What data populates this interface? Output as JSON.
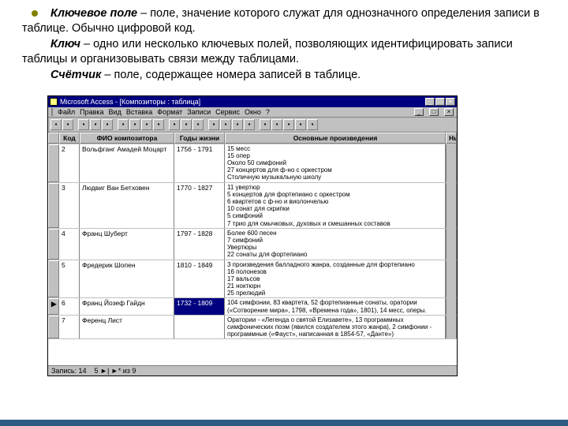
{
  "paragraphs": {
    "p1_term": "Ключевое поле",
    "p1_rest": " – поле, значение которого служат для однозначного определения записи в таблице. Обычно цифровой код.",
    "p2_term": "Ключ",
    "p2_rest": " – одно или несколько ключевых полей, позволяющих идентифицировать записи таблицы и организовывать связи между таблицами.",
    "p3_term": "Счётчик",
    "p3_rest": "  –  поле, содержащее номера записей в таблице."
  },
  "app": {
    "title": "Microsoft Access - [Композиторы : таблица]",
    "menu": [
      "Файл",
      "Правка",
      "Вид",
      "Вставка",
      "Формат",
      "Записи",
      "Сервис",
      "Окно",
      "?"
    ],
    "toolbar_icons": [
      "grid-icon",
      "save-icon",
      "print-icon",
      "preview-icon",
      "spell-icon",
      "cut-icon",
      "copy-icon",
      "paste-icon",
      "undo-icon",
      "link-icon",
      "sort-asc-icon",
      "sort-desc-icon",
      "filter-icon",
      "filter-form-icon",
      "find-icon",
      "goto-icon",
      "new-icon",
      "delete-icon",
      "db-icon",
      "rel-icon",
      "help-icon"
    ],
    "columns": {
      "code": "Код",
      "name": "ФИО композитора",
      "years": "Годы жизни",
      "works": "Основные произведения",
      "last": "Нь"
    },
    "rows": [
      {
        "code": "2",
        "name": "Вольфганг Амадей Моцарт",
        "years": "1756 - 1791",
        "works": "15 месс\n15 опер\nОколо 50 симфоний\n27 концертов для ф-но с оркестром\nСтоличную музыкальную школу"
      },
      {
        "code": "3",
        "name": "Людвиг Ван Бетховен",
        "years": "1770 - 1827",
        "works": "11 увертюр\n5 концертов для фортепиано с оркестром\n6 квартетов с ф-но и виолончелью\n10 сонат для скрипки\n5 симфоний\n7 трио для смычковых, духовых и смешанных составов"
      },
      {
        "code": "4",
        "name": "Франц Шуберт",
        "years": "1797 - 1828",
        "works": "Более 600 песен\n7 симфоний\nУвертюры\n22 сонаты для фортепиано"
      },
      {
        "code": "5",
        "name": "Фредерик Шопен",
        "years": "1810 - 1849",
        "works": "3 произведения балладного жанра, созданные для фортепиано\n16 полонезов\n17 вальсов\n21 ноктюрн\n25 прелюдий"
      },
      {
        "code": "6",
        "name": "Франц Йозеф Гайдн",
        "years": "1732 - 1809",
        "works": "104 симфонии, 83 квартета, 52 фортепианные сонаты, оратории («Сотворение мира», 1798, «Времена года», 1801), 14 месс, оперы.",
        "selected": true
      },
      {
        "code": "7",
        "name": "Ференц Лист",
        "years": "",
        "works": "Оратории - «Легенда о святой Елизавете», 13 программных симфонических поэм (явился создателем этого жанра), 2 симфонии - программные («Фауст», написанная в 1854-57, «Данте»)"
      }
    ],
    "status": {
      "left": "Запись: 14",
      "mid": "5  ►|  ►*   из 9"
    }
  }
}
